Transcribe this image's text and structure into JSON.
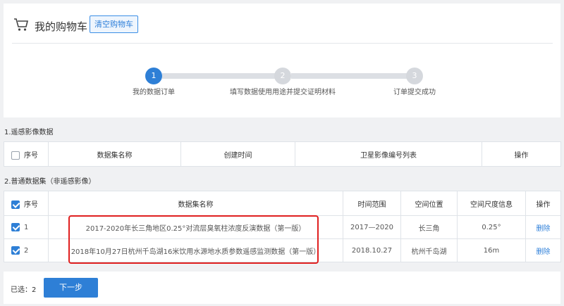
{
  "header": {
    "title": "我的购物车",
    "clear_button": "清空购物车"
  },
  "steps": [
    {
      "number": "1",
      "label": "我的数据订单",
      "state": "active"
    },
    {
      "number": "2",
      "label": "填写数据使用用途并提交证明材料",
      "state": "todo"
    },
    {
      "number": "3",
      "label": "订单提交成功",
      "state": "todo"
    }
  ],
  "remote_section": {
    "title": "1.遥感影像数据",
    "columns": [
      "序号",
      "数据集名称",
      "创建时间",
      "卫星影像编号列表",
      "操作"
    ]
  },
  "common_section": {
    "title": "2.普通数据集（非遥感影像）",
    "columns": [
      "序号",
      "数据集名称",
      "时间范围",
      "空间位置",
      "空间尺度信息",
      "操作"
    ],
    "rows": [
      {
        "index": "1",
        "name": "2017-2020年长三角地区0.25°对流层臭氧柱浓度反演数据（第一版）",
        "time_range": "2017—2020",
        "location": "长三角",
        "scale": "0.25°",
        "action": "删除",
        "checked": true
      },
      {
        "index": "2",
        "name": "2018年10月27日杭州千岛湖16米饮用水源地水质参数遥感监测数据（第一版）",
        "time_range": "2018.10.27",
        "location": "杭州千岛湖",
        "scale": "16m",
        "action": "删除",
        "checked": true
      }
    ]
  },
  "footer": {
    "selected_label": "已选：2",
    "next_button": "下一步"
  },
  "colors": {
    "accent": "#2e7fd6",
    "highlight": "#e02020"
  }
}
